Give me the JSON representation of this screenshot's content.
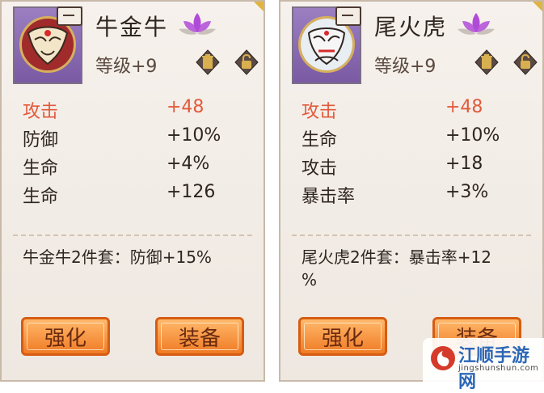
{
  "panels": [
    {
      "name": "牛金牛",
      "level": "等级+9",
      "stats": [
        {
          "label": "攻击",
          "value": "+48"
        },
        {
          "label": "防御",
          "value": "+10%"
        },
        {
          "label": "生命",
          "value": "+4%"
        },
        {
          "label": "生命",
          "value": "+126"
        }
      ],
      "set_bonus": "牛金牛2件套：防御+15%",
      "upgrade_label": "强化",
      "equip_label": "装备"
    },
    {
      "name": "尾火虎",
      "level": "等级+9",
      "stats": [
        {
          "label": "攻击",
          "value": "+48"
        },
        {
          "label": "生命",
          "value": "+10%"
        },
        {
          "label": "攻击",
          "value": "+18"
        },
        {
          "label": "暴击率",
          "value": "+3%"
        }
      ],
      "set_bonus": "尾火虎2件套：暴击率+12\n%",
      "upgrade_label": "强化",
      "equip_label": "装备"
    }
  ],
  "watermark": {
    "title": "江顺手游网",
    "subtitle": "jingshunshun.com"
  },
  "colors": {
    "primary_stat": "#e25a3b",
    "button_orange": "#f07b25",
    "avatar_frame_purple": "#7a5aa3",
    "lotus_purple": "#b04bd8"
  },
  "icons": {
    "avatar_left": "bull-mask-avatar",
    "avatar_right": "tiger-mask-avatar",
    "trash": "trash-icon",
    "lock": "lock-icon",
    "lotus": "lotus-icon"
  }
}
